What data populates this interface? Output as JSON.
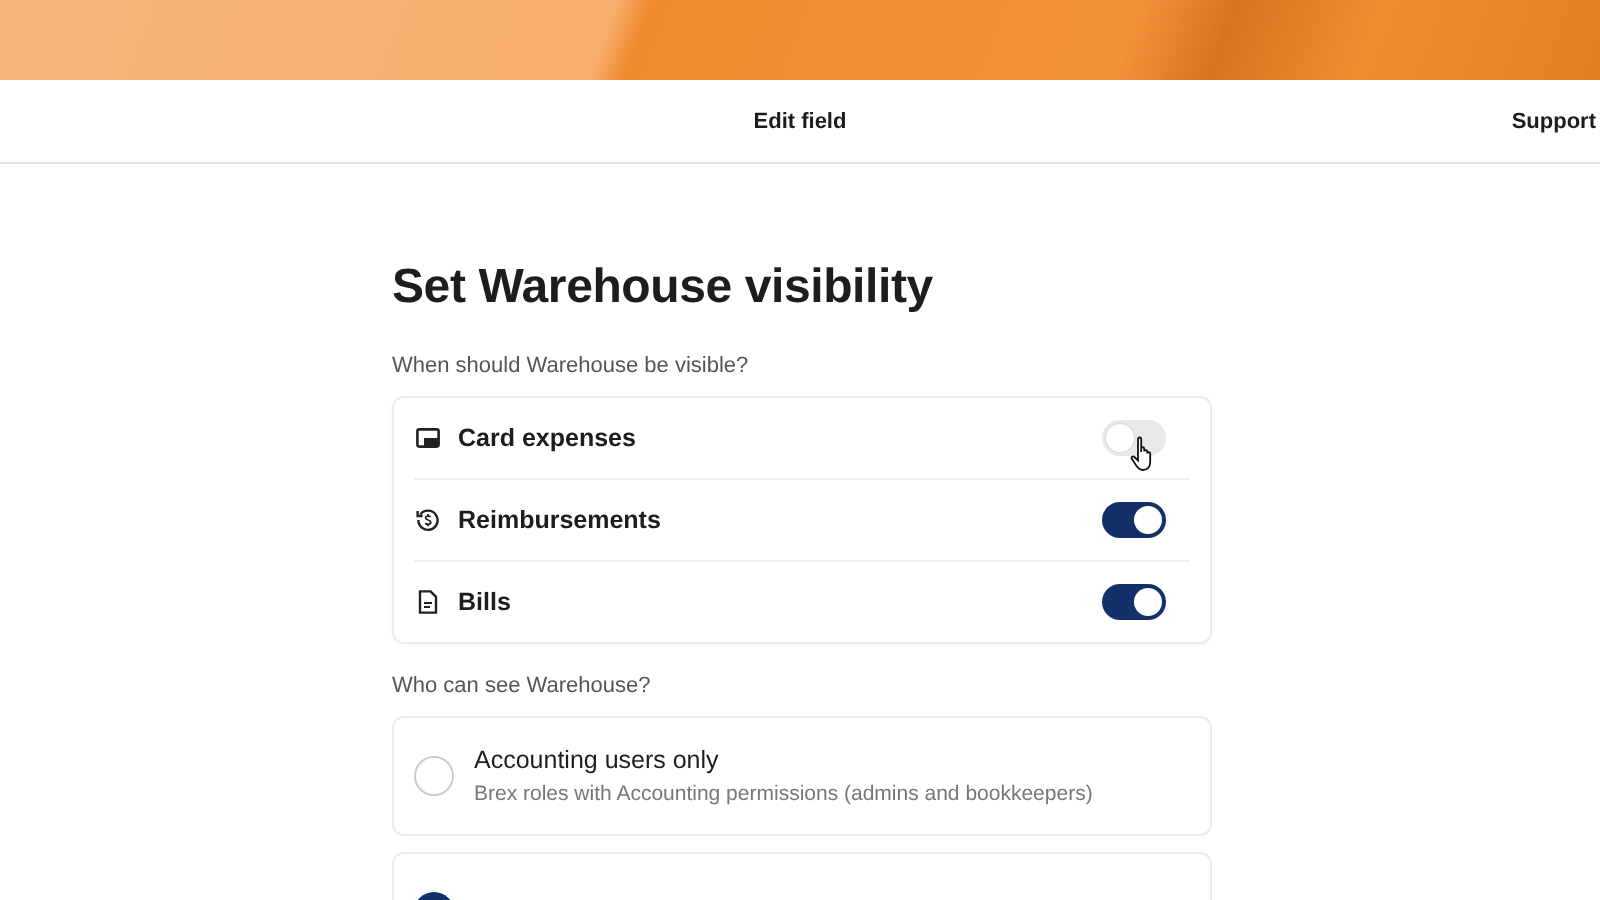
{
  "header": {
    "title": "Edit field",
    "support": "Support"
  },
  "heading": "Set Warehouse visibility",
  "visibility": {
    "question": "When should Warehouse be visible?",
    "items": [
      {
        "kind": "card",
        "label": "Card expenses",
        "on": false
      },
      {
        "kind": "reimbursement",
        "label": "Reimbursements",
        "on": true
      },
      {
        "kind": "bill",
        "label": "Bills",
        "on": true
      }
    ]
  },
  "access": {
    "question": "Who can see Warehouse?",
    "options": [
      {
        "label": "Accounting users only",
        "description": "Brex roles with Accounting permissions (admins and bookkeepers)",
        "selected": false
      },
      {
        "selected": true
      }
    ]
  }
}
